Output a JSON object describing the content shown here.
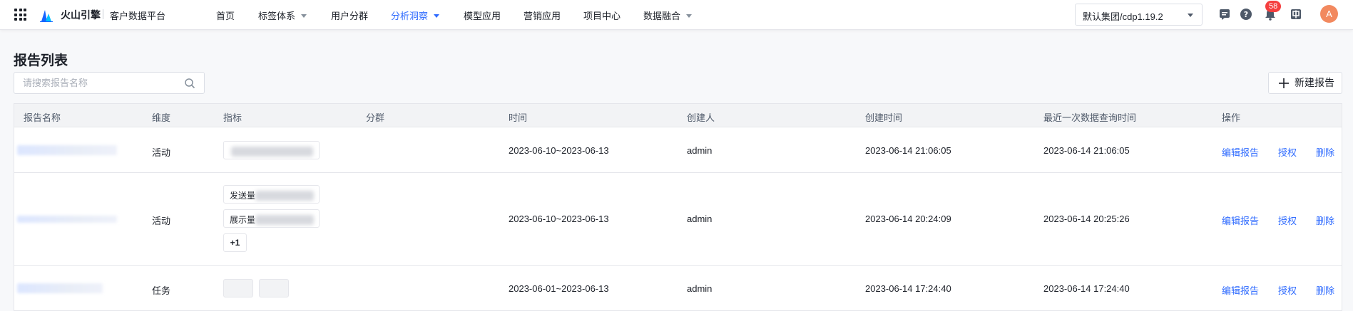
{
  "header": {
    "brand": "火山引擎",
    "product": "客户数据平台",
    "nav": [
      {
        "label": "首页",
        "has_caret": false,
        "active": false
      },
      {
        "label": "标签体系",
        "has_caret": true,
        "active": false
      },
      {
        "label": "用户分群",
        "has_caret": false,
        "active": false
      },
      {
        "label": "分析洞察",
        "has_caret": true,
        "active": true
      },
      {
        "label": "模型应用",
        "has_caret": false,
        "active": false
      },
      {
        "label": "营销应用",
        "has_caret": false,
        "active": false
      },
      {
        "label": "项目中心",
        "has_caret": false,
        "active": false
      },
      {
        "label": "数据融合",
        "has_caret": true,
        "active": false
      }
    ],
    "tenant": "默认集团/cdp1.19.2",
    "notification_count": "58",
    "avatar_letter": "A",
    "icons": [
      "apps-grid-icon",
      "volcano-logo-icon",
      "message-icon",
      "help-icon",
      "bell-icon",
      "language-icon"
    ]
  },
  "page": {
    "title": "报告列表",
    "search_placeholder": "请搜索报告名称",
    "new_button": "新建报告"
  },
  "table": {
    "columns": [
      "报告名称",
      "维度",
      "指标",
      "分群",
      "时间",
      "创建人",
      "创建时间",
      "最近一次数据查询时间",
      "操作"
    ],
    "actions": [
      "编辑报告",
      "授权",
      "删除"
    ],
    "rows": [
      {
        "dimension": "活动",
        "metrics": [],
        "time_range": "2023-06-10~2023-06-13",
        "creator": "admin",
        "created_at": "2023-06-14 21:06:05",
        "last_query": "2023-06-14 21:06:05"
      },
      {
        "dimension": "活动",
        "metrics": [
          "发送量",
          "展示量"
        ],
        "more": "+1",
        "time_range": "2023-06-10~2023-06-13",
        "creator": "admin",
        "created_at": "2023-06-14 20:24:09",
        "last_query": "2023-06-14 20:25:26"
      },
      {
        "dimension": "任务",
        "metrics": [],
        "time_range": "2023-06-01~2023-06-13",
        "creator": "admin",
        "created_at": "2023-06-14 17:24:40",
        "last_query": "2023-06-14 17:24:40"
      }
    ]
  },
  "colors": {
    "accent": "#2f6bff",
    "badge": "#f53f3f",
    "avatar": "#f2895f"
  }
}
